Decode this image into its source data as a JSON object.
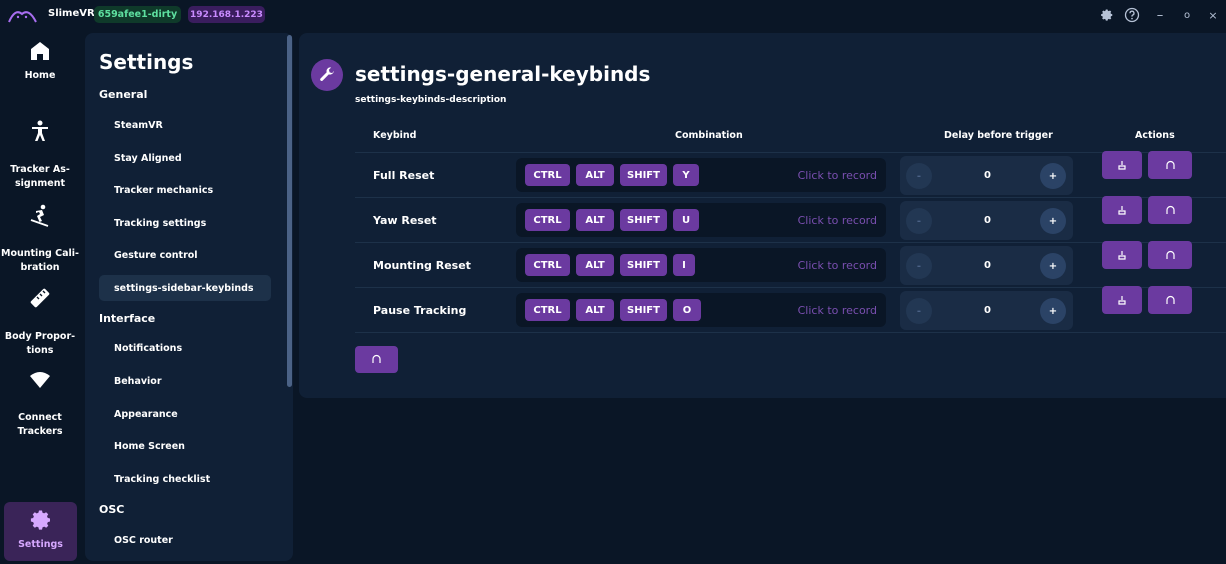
{
  "titlebar": {
    "app_name": "SlimeVR",
    "version_badge": "659afee1-dirty",
    "ip_badge": "192.168.1.223",
    "icons": [
      "settings-icon",
      "help-icon",
      "minimize-icon",
      "maximize-icon",
      "close-icon"
    ],
    "minimize_glyph": "–",
    "maximize_glyph": "o",
    "close_glyph": "×"
  },
  "nav": {
    "items": [
      {
        "label": "Home",
        "icon": "home-icon"
      },
      {
        "label": "Tracker As-\nsignment",
        "icon": "person-icon"
      },
      {
        "label": "Mounting Cali-\nbration",
        "icon": "skier-icon"
      },
      {
        "label": "Body Propor-\ntions",
        "icon": "ruler-icon"
      },
      {
        "label": "Connect\nTrackers",
        "icon": "wifi-icon"
      },
      {
        "label": "Settings",
        "icon": "gear-icon",
        "active": true
      }
    ]
  },
  "sidebar": {
    "title": "Settings",
    "sections": [
      {
        "title": "General",
        "items": [
          "SteamVR",
          "Stay Aligned",
          "Tracker mechanics",
          "Tracking settings",
          "Gesture control",
          "settings-sidebar-keybinds"
        ]
      },
      {
        "title": "Interface",
        "items": [
          "Notifications",
          "Behavior",
          "Appearance",
          "Home Screen",
          "Tracking checklist"
        ]
      },
      {
        "title": "OSC",
        "items": [
          "OSC router"
        ]
      }
    ],
    "active_item": "settings-sidebar-keybinds"
  },
  "main": {
    "title": "settings-general-keybinds",
    "description": "settings-keybinds-description",
    "header_icon": "wrench-icon",
    "columns": {
      "keybind": "Keybind",
      "combination": "Combination",
      "delay": "Delay before trigger",
      "actions": "Actions"
    },
    "rows": [
      {
        "name": "Full Reset",
        "keys": [
          "CTRL",
          "ALT",
          "SHIFT",
          "Y"
        ],
        "hint": "Click to record",
        "delay": "0",
        "minus": "-",
        "plus": "+"
      },
      {
        "name": "Yaw Reset",
        "keys": [
          "CTRL",
          "ALT",
          "SHIFT",
          "U"
        ],
        "hint": "Click to record",
        "delay": "0",
        "minus": "-",
        "plus": "+"
      },
      {
        "name": "Mounting Reset",
        "keys": [
          "CTRL",
          "ALT",
          "SHIFT",
          "I"
        ],
        "hint": "Click to record",
        "delay": "0",
        "minus": "-",
        "plus": "+"
      },
      {
        "name": "Pause Tracking",
        "keys": [
          "CTRL",
          "ALT",
          "SHIFT",
          "O"
        ],
        "hint": "Click to record",
        "delay": "0",
        "minus": "-",
        "plus": "+"
      }
    ]
  },
  "colors": {
    "background": "#0a1626",
    "panel": "#102036",
    "accent": "#6b3aa0",
    "hint": "#7a4fb0",
    "version_badge": "#5ee0a0",
    "ip_badge": "#c98bff"
  }
}
